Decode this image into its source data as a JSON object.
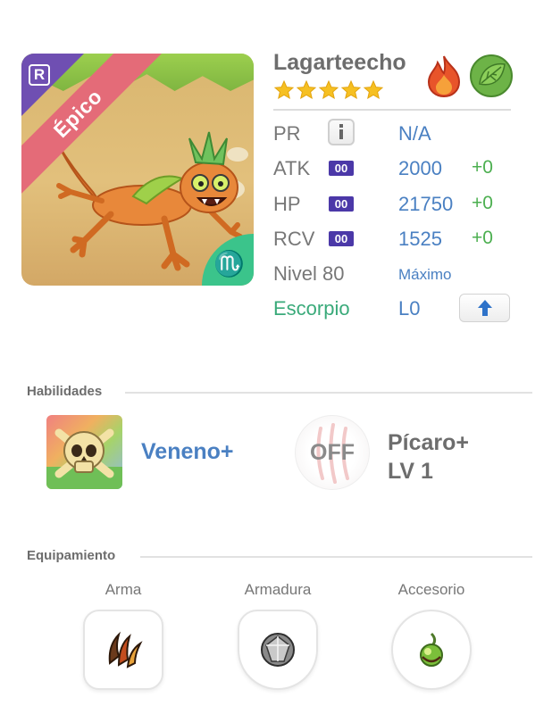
{
  "card": {
    "rarity": "Épico",
    "rarity_badge": "R",
    "zodiac_symbol": "♏",
    "colors": {
      "rarity_ribbon": "#e46b78",
      "corner": "#6f4fb2",
      "zodiac_corner": "#3bc48b"
    }
  },
  "monster": {
    "name": "Lagarteecho",
    "stars": 5,
    "elements": [
      "fire-element-icon",
      "leaf-element-icon"
    ]
  },
  "stats": {
    "pr": {
      "label": "PR",
      "value": "N/A"
    },
    "atk": {
      "label": "ATK",
      "tag": "00",
      "value": "2000",
      "bonus": "+0"
    },
    "hp": {
      "label": "HP",
      "tag": "00",
      "value": "21750",
      "bonus": "+0"
    },
    "rcv": {
      "label": "RCV",
      "tag": "00",
      "value": "1525",
      "bonus": "+0"
    },
    "level": {
      "label": "Nivel 80",
      "value": "Máximo"
    },
    "zodiac": {
      "label": "Escorpio",
      "value": "L0"
    }
  },
  "skills": {
    "title": "Habilidades",
    "active": {
      "name": "Veneno+"
    },
    "leader": {
      "status": "OFF",
      "name_line1": "Pícaro+",
      "name_line2": "LV 1"
    }
  },
  "equipment": {
    "title": "Equipamiento",
    "slots": [
      {
        "label": "Arma",
        "icon": "claw-weapon-icon"
      },
      {
        "label": "Armadura",
        "icon": "crystal-armor-icon"
      },
      {
        "label": "Accesorio",
        "icon": "green-orb-accessory-icon"
      }
    ]
  }
}
